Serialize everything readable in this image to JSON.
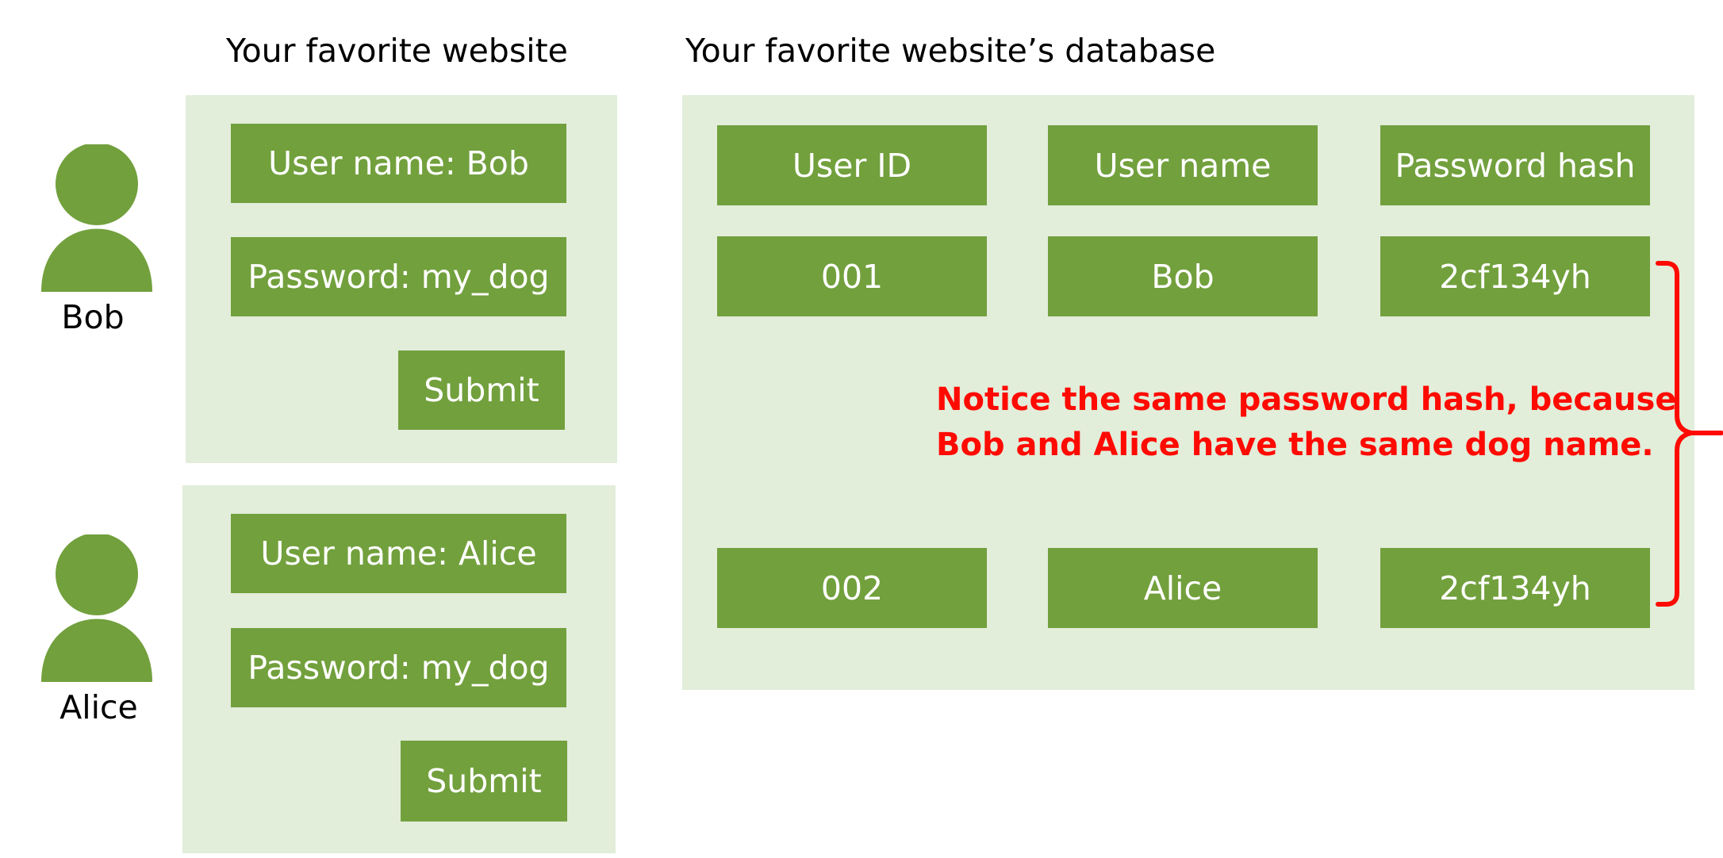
{
  "headings": {
    "website": "Your favorite website",
    "database": "Your favorite website’s database"
  },
  "users": [
    {
      "name": "Bob",
      "username_field": "User name: Bob",
      "password_field": "Password: my_dog",
      "submit_label": "Submit"
    },
    {
      "name": "Alice",
      "username_field": "User name: Alice",
      "password_field": "Password: my_dog",
      "submit_label": "Submit"
    }
  ],
  "database": {
    "columns": [
      "User ID",
      "User name",
      "Password hash"
    ],
    "rows": [
      [
        "001",
        "Bob",
        "2cf134yh"
      ],
      [
        "002",
        "Alice",
        "2cf134yh"
      ]
    ]
  },
  "note": {
    "line1": "Notice the same password hash, because",
    "line2": "Bob and Alice have the same dog name."
  },
  "colors": {
    "panel": "#e2edda",
    "box": "#72a03d",
    "person": "#72a03d",
    "note": "#ff0a00",
    "bracket": "#ff0a00"
  },
  "icons": [
    "person-icon",
    "bracket"
  ]
}
